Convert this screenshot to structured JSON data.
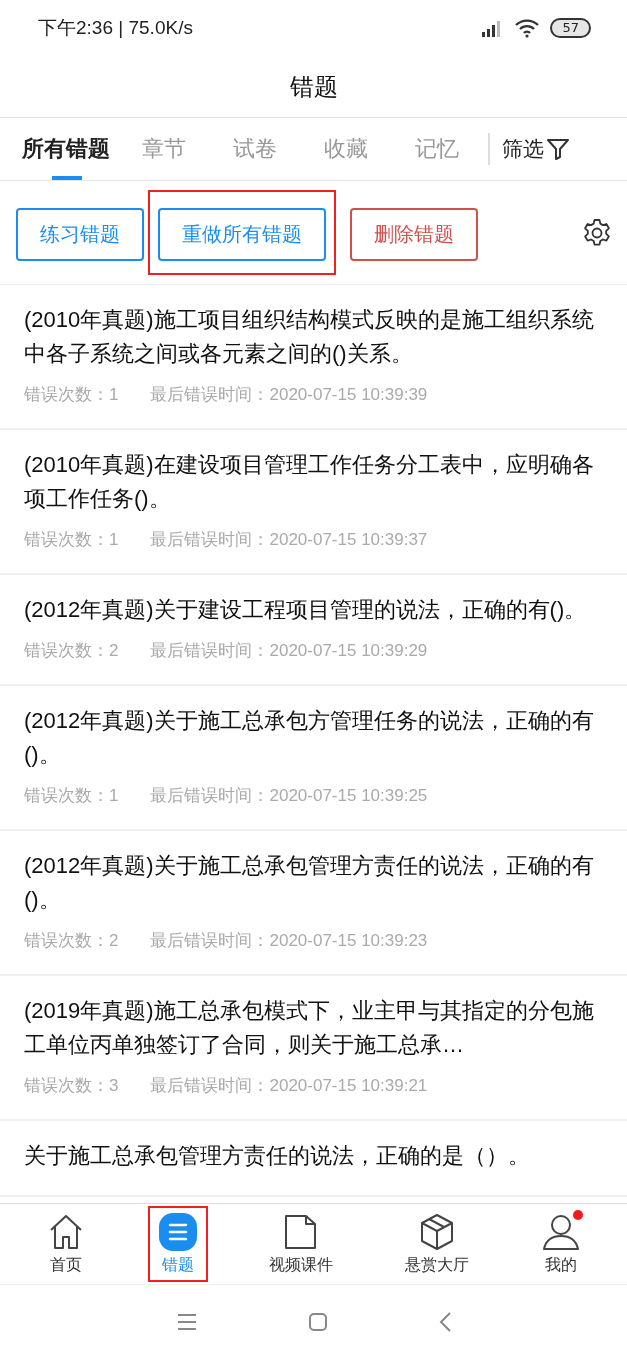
{
  "status_bar": {
    "time": "下午2:36 | 75.0K/s",
    "battery": "57"
  },
  "title": "错题",
  "tabs": [
    {
      "label": "所有错题",
      "selected": true
    },
    {
      "label": "章节",
      "selected": false
    },
    {
      "label": "试卷",
      "selected": false
    },
    {
      "label": "收藏",
      "selected": false
    },
    {
      "label": "记忆",
      "selected": false
    }
  ],
  "filter": {
    "label": "筛选"
  },
  "actions": [
    {
      "label": "练习错题",
      "kind": "primary",
      "highlighted": false
    },
    {
      "label": "重做所有错题",
      "kind": "primary",
      "highlighted": true
    },
    {
      "label": "删除错题",
      "kind": "danger",
      "highlighted": false
    }
  ],
  "questions": [
    {
      "text": "(2010年真题)施工项目组织结构模式反映的是施工组织系统中各子系统之间或各元素之间的()关系。",
      "count": "错误次数：1",
      "time": "最后错误时间：2020-07-15 10:39:39"
    },
    {
      "text": "(2010年真题)在建设项目管理工作任务分工表中，应明确各项工作任务()。",
      "count": "错误次数：1",
      "time": "最后错误时间：2020-07-15 10:39:37"
    },
    {
      "text": "(2012年真题)关于建设工程项目管理的说法，正确的有()。",
      "count": "错误次数：2",
      "time": "最后错误时间：2020-07-15 10:39:29"
    },
    {
      "text": "(2012年真题)关于施工总承包方管理任务的说法，正确的有()。",
      "count": "错误次数：1",
      "time": "最后错误时间：2020-07-15 10:39:25"
    },
    {
      "text": "(2012年真题)关于施工总承包管理方责任的说法，正确的有()。",
      "count": "错误次数：2",
      "time": "最后错误时间：2020-07-15 10:39:23"
    },
    {
      "text": "(2019年真题)施工总承包模式下，业主甲与其指定的分包施工单位丙单独签订了合同，则关于施工总承…",
      "count": "错误次数：3",
      "time": "最后错误时间：2020-07-15 10:39:21"
    },
    {
      "text": "关于施工总承包管理方责任的说法，正确的是（）。"
    }
  ],
  "nav": [
    {
      "label": "首页",
      "kind": "home",
      "selected": false,
      "highlighted": false,
      "badge": false
    },
    {
      "label": "错题",
      "kind": "list",
      "selected": true,
      "highlighted": true,
      "badge": false
    },
    {
      "label": "视频课件",
      "kind": "folder",
      "selected": false,
      "highlighted": false,
      "badge": false
    },
    {
      "label": "悬赏大厅",
      "kind": "cube",
      "selected": false,
      "highlighted": false,
      "badge": false
    },
    {
      "label": "我的",
      "kind": "user",
      "selected": false,
      "highlighted": false,
      "badge": true
    }
  ]
}
